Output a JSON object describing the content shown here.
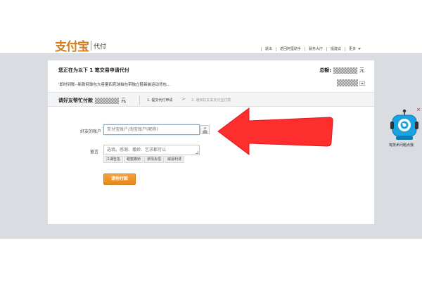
{
  "header": {
    "logo_main": "支付宝",
    "logo_sub": "代付",
    "nav": [
      "退出",
      "返回阿里助手",
      "服务大厅",
      "提建议",
      "更多"
    ]
  },
  "order": {
    "title": "您正在为以下 1 笔交易申请代付",
    "total_label": "总额:",
    "unit": "元",
    "item_text": "'即时到账--新款网球包大容量四克球拍包带独立鞋袋装运动背包..."
  },
  "steps": {
    "title": "请好友帮忙付款",
    "unit": "元",
    "step1": "1. 提交代付申请",
    "arrow": ">",
    "step2": "2. 通知好友来支付宝付款"
  },
  "form": {
    "account_label": "好友的账户",
    "account_placeholder": "支付宝账户/淘宝账户(昵称)",
    "message_label": "留言",
    "message_placeholder": "选填。感谢、撒娇、乞求都可以",
    "quick_tags": [
      "江湖告急",
      "甜蜜撒娇",
      "亲情永恒",
      "威逼利诱"
    ],
    "pay_button": "请他付款"
  },
  "help": {
    "label": "有技术问题点我",
    "close": "×"
  },
  "colors": {
    "accent_orange": "#e8871a",
    "arrow_red": "#ff2e2e",
    "focus_blue": "#6fb7e6",
    "help_blue": "#1aa3e0"
  }
}
